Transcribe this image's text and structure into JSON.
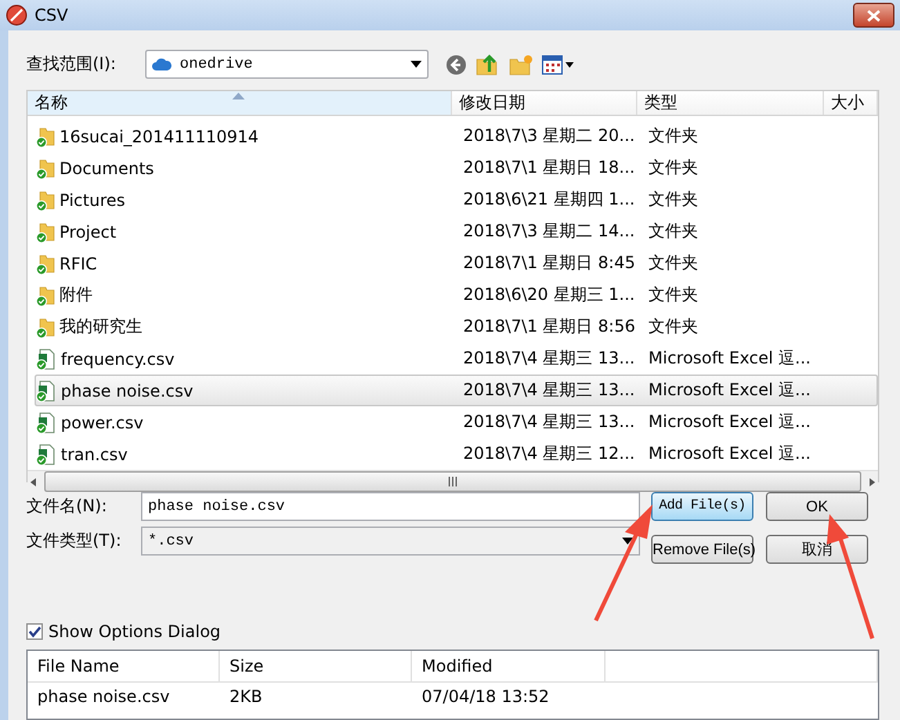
{
  "window": {
    "title": "CSV"
  },
  "look_in": {
    "label": "查找范围(I):",
    "value": "onedrive"
  },
  "file_list": {
    "columns": [
      {
        "label": "名称",
        "sorted": true
      },
      {
        "label": "修改日期",
        "sorted": false
      },
      {
        "label": "类型",
        "sorted": false
      },
      {
        "label": "大小",
        "sorted": false
      }
    ],
    "rows": [
      {
        "kind": "folder",
        "name": "16sucai_201411110914",
        "date": "2018\\7\\3 星期二 20...",
        "type": "文件夹",
        "selected": false
      },
      {
        "kind": "folder",
        "name": "Documents",
        "date": "2018\\7\\1 星期日 18...",
        "type": "文件夹",
        "selected": false
      },
      {
        "kind": "folder",
        "name": "Pictures",
        "date": "2018\\6\\21 星期四 1...",
        "type": "文件夹",
        "selected": false
      },
      {
        "kind": "folder",
        "name": "Project",
        "date": "2018\\7\\3 星期二 14...",
        "type": "文件夹",
        "selected": false
      },
      {
        "kind": "folder",
        "name": "RFIC",
        "date": "2018\\7\\1 星期日 8:45",
        "type": "文件夹",
        "selected": false
      },
      {
        "kind": "folder",
        "name": "附件",
        "date": "2018\\6\\20 星期三 1...",
        "type": "文件夹",
        "selected": false
      },
      {
        "kind": "folder",
        "name": "我的研究生",
        "date": "2018\\7\\1 星期日 8:56",
        "type": "文件夹",
        "selected": false
      },
      {
        "kind": "excel",
        "name": "frequency.csv",
        "date": "2018\\7\\4 星期三 13...",
        "type": "Microsoft Excel 逗...",
        "selected": false
      },
      {
        "kind": "excel",
        "name": "phase noise.csv",
        "date": "2018\\7\\4 星期三 13...",
        "type": "Microsoft Excel 逗...",
        "selected": true
      },
      {
        "kind": "excel",
        "name": "power.csv",
        "date": "2018\\7\\4 星期三 13...",
        "type": "Microsoft Excel 逗...",
        "selected": false
      },
      {
        "kind": "excel",
        "name": "tran.csv",
        "date": "2018\\7\\4 星期三 12...",
        "type": "Microsoft Excel 逗...",
        "selected": false
      }
    ]
  },
  "file_name": {
    "label": "文件名(N):",
    "value": "phase noise.csv"
  },
  "file_type": {
    "label": "文件类型(T):",
    "value": "*.csv"
  },
  "buttons": [
    {
      "label": "Add File(s)",
      "focused": true
    },
    {
      "label": "OK",
      "focused": false
    },
    {
      "label": "Remove File(s)",
      "focused": false
    },
    {
      "label": "取消",
      "focused": false
    }
  ],
  "show_options": {
    "label": "Show Options Dialog",
    "checked": true
  },
  "selected_files": {
    "columns": [
      "File Name",
      "Size",
      "Modified"
    ],
    "rows": [
      {
        "file_name": "phase noise.csv",
        "size": "2KB",
        "modified": "07/04/18 13:52"
      }
    ]
  }
}
